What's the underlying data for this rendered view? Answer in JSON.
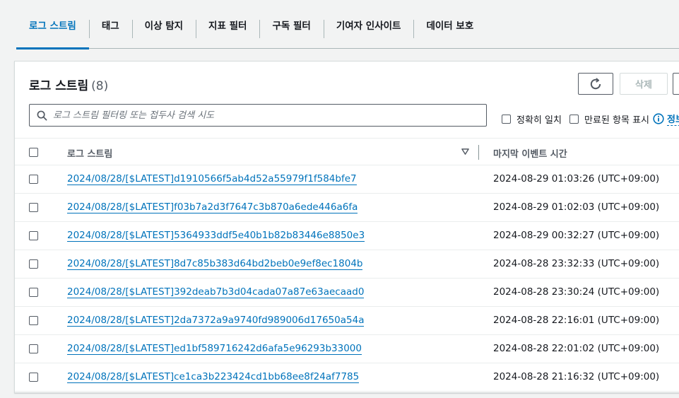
{
  "tabs": [
    {
      "label": "로그 스트림",
      "active": true
    },
    {
      "label": "태그"
    },
    {
      "label": "이상 탐지"
    },
    {
      "label": "지표 필터"
    },
    {
      "label": "구독 필터"
    },
    {
      "label": "기여자 인사이트"
    },
    {
      "label": "데이터 보호"
    }
  ],
  "panel": {
    "title": "로그 스트림",
    "count": "(8)",
    "delete_label": "삭제",
    "search_placeholder": "로그 스트림 필터링 또는 접두사 검색 시도",
    "exact_match_label": "정확히 일치",
    "show_expired_label": "만료된 항목 표시",
    "info_label": "정보"
  },
  "table": {
    "columns": [
      "로그 스트림",
      "마지막 이벤트 시간"
    ],
    "rows": [
      {
        "name": "2024/08/28/[$LATEST]d1910566f5ab4d52a55979f1f584bfe7",
        "time": "2024-08-29 01:03:26 (UTC+09:00)"
      },
      {
        "name": "2024/08/28/[$LATEST]f03b7a2d3f7647c3b870a6ede446a6fa",
        "time": "2024-08-29 01:02:03 (UTC+09:00)"
      },
      {
        "name": "2024/08/28/[$LATEST]5364933ddf5e40b1b82b83446e8850e3",
        "time": "2024-08-29 00:32:27 (UTC+09:00)"
      },
      {
        "name": "2024/08/28/[$LATEST]8d7c85b383d64bd2beb0e9ef8ec1804b",
        "time": "2024-08-28 23:32:33 (UTC+09:00)"
      },
      {
        "name": "2024/08/28/[$LATEST]392deab7b3d04cada07a87e63aecaad0",
        "time": "2024-08-28 23:30:24 (UTC+09:00)"
      },
      {
        "name": "2024/08/28/[$LATEST]2da7372a9a9740fd989006d17650a54a",
        "time": "2024-08-28 22:16:01 (UTC+09:00)"
      },
      {
        "name": "2024/08/28/[$LATEST]ed1bf589716242d6afa5e96293b33000",
        "time": "2024-08-28 22:01:02 (UTC+09:00)"
      },
      {
        "name": "2024/08/28/[$LATEST]ce1ca3b223424cd1bb68ee8f24af7785",
        "time": "2024-08-28 21:16:32 (UTC+09:00)"
      }
    ]
  },
  "colors": {
    "link": "#0073bb",
    "text": "#16191f",
    "border": "#aab7b8",
    "background": "#f2f3f3"
  },
  "icons": {
    "refresh": "refresh-icon",
    "search": "search-icon",
    "info": "info-icon",
    "sort": "sort-down-icon"
  }
}
